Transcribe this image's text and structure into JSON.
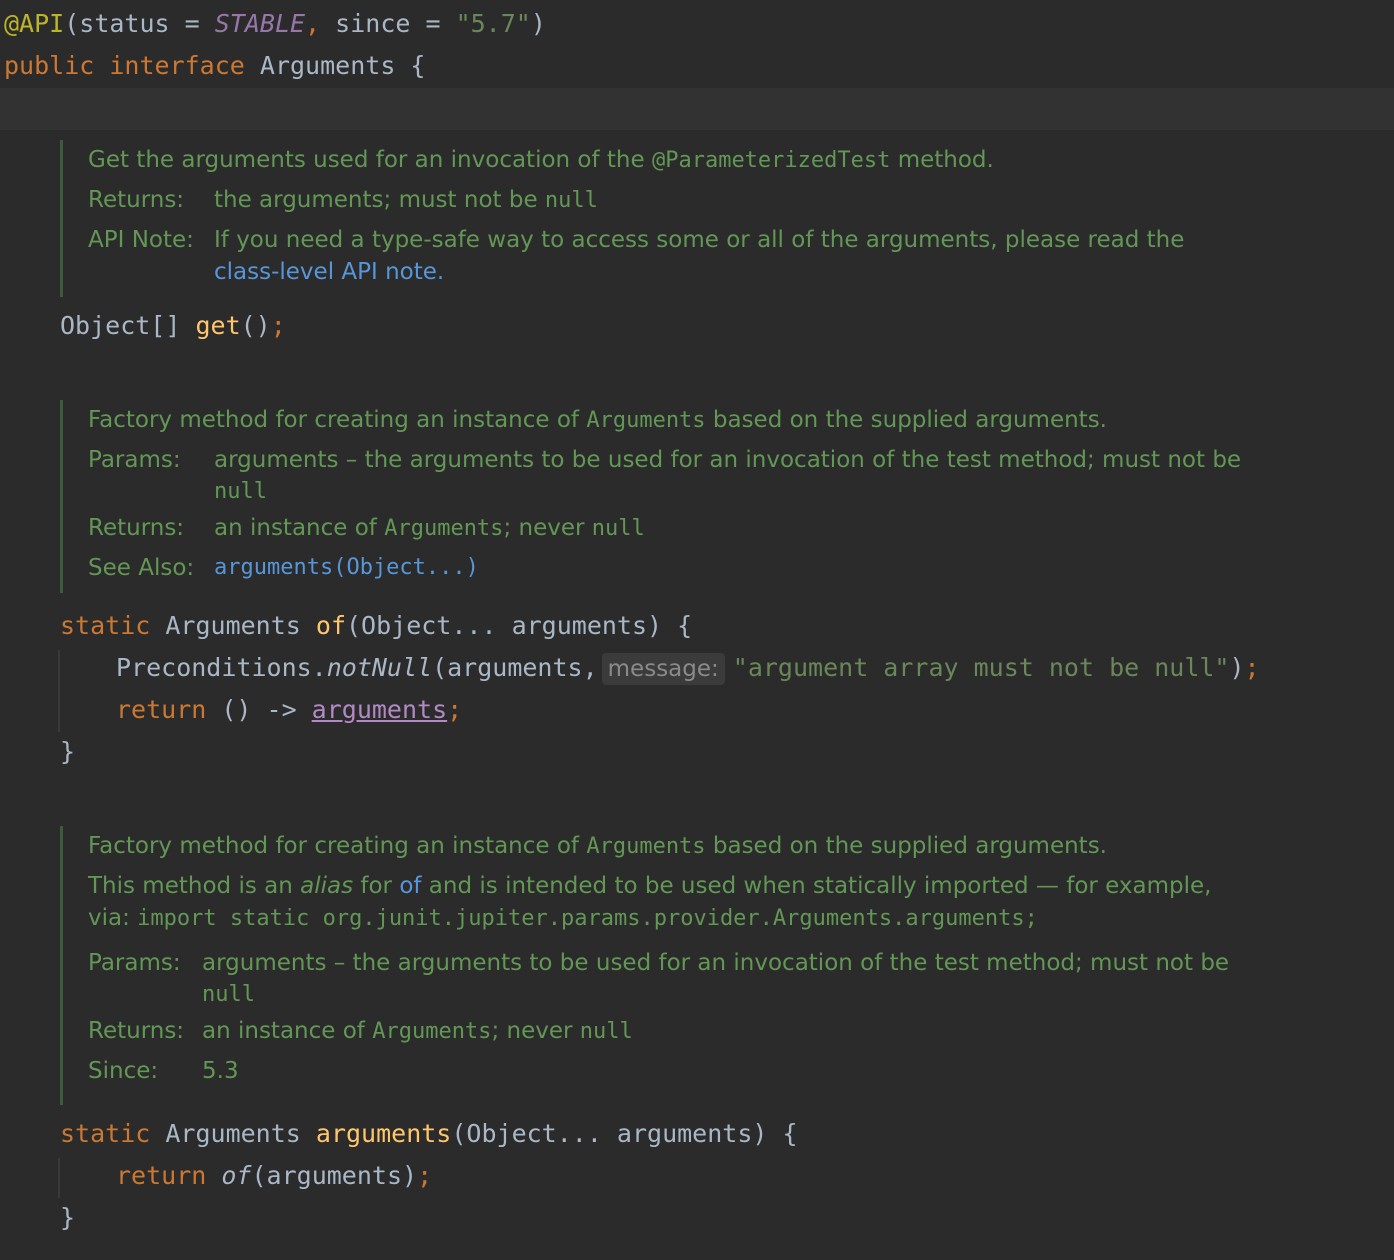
{
  "code": {
    "ann_api": "@API",
    "ann_open": "(status = ",
    "ann_stable": "STABLE",
    "ann_comma": ",",
    "ann_since": " since = ",
    "ann_version": "\"5.7\"",
    "ann_close": ")",
    "kw_public": "public",
    "kw_interface": "interface",
    "interface_name": "Arguments",
    "brace_open": " {",
    "get_type": "Object[] ",
    "get_name": "get",
    "get_parens": "()",
    "semicolon": ";",
    "kw_static": "static",
    "ret_type": " Arguments ",
    "of_name": "of",
    "of_params": "(Object... arguments) {",
    "precond": "Preconditions.",
    "notnull": "notNull",
    "notnull_args": "(arguments,",
    "hint_message": "message:",
    "notnull_str": "\"argument array must not be null\"",
    "paren_close": ")",
    "kw_return": "return",
    "lambda": " () -> ",
    "field_arguments": "arguments",
    "close_brace": "}",
    "arguments_name": "arguments",
    "arguments_params": "(Object... arguments) {",
    "of_call": "of",
    "of_call_args": "(arguments)"
  },
  "doc_get": {
    "summary_a": "Get the arguments used for an invocation of the ",
    "summary_code": "@ParameterizedTest",
    "summary_b": " method.",
    "returns_label": "Returns:",
    "returns_a": "the arguments; must not be ",
    "returns_code": "null",
    "apinote_label": "API Note:",
    "apinote_text": "If you need a type-safe way to access some or all of the arguments, please read the",
    "apinote_link": "class-level API note."
  },
  "doc_of": {
    "summary_a": "Factory method for creating an instance of ",
    "summary_code": "Arguments",
    "summary_b": " based on the supplied arguments.",
    "params_label": "Params:",
    "params_text": "arguments – the arguments to be used for an invocation of the test method; must not be",
    "params_null": "null",
    "returns_label": "Returns:",
    "returns_a": "an instance of ",
    "returns_code": "Arguments",
    "returns_b": "; never ",
    "returns_null": "null",
    "seealso_label": "See Also:",
    "seealso_link": "arguments(Object...)"
  },
  "doc_arguments": {
    "summary_a": "Factory method for creating an instance of ",
    "summary_code": "Arguments",
    "summary_b": " based on the supplied arguments.",
    "alias_a": "This method is an ",
    "alias_em": "alias",
    "alias_b": " for ",
    "alias_link": "of",
    "alias_c": " and is intended to be used when statically imported — for example,",
    "via": "via: ",
    "import_code": "import static org.junit.jupiter.params.provider.Arguments.arguments;",
    "params_label": "Params:",
    "params_text": "arguments – the arguments to be used for an invocation of the test method; must not be",
    "params_null": "null",
    "returns_label": "Returns:",
    "returns_a": "an instance of ",
    "returns_code": "Arguments",
    "returns_b": "; never ",
    "returns_null": "null",
    "since_label": "Since:",
    "since_value": "5.3"
  }
}
